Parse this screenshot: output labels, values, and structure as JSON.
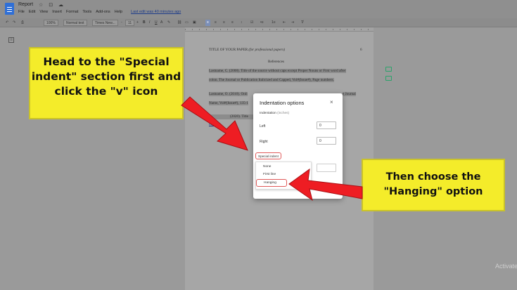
{
  "app": {
    "doc_title": "Report",
    "title_icons": "☆ ⊡ ☁",
    "menu": [
      "File",
      "Edit",
      "View",
      "Insert",
      "Format",
      "Tools",
      "Add-ons",
      "Help"
    ],
    "last_edit": "Last edit was 40 minutes ago"
  },
  "toolbar": {
    "undo": "↶",
    "redo": "↷",
    "print": "⎙",
    "zoom": "100%",
    "style": "Normal text",
    "font": "Times New...",
    "font_size": "11",
    "bold": "B",
    "italic": "I",
    "underline": "U",
    "text_color": "A",
    "minus": "-",
    "plus": "+"
  },
  "document": {
    "header_title": "TITLE OF YOUR PAPER",
    "header_subtitle": "(for professional papers)",
    "page_number": "6",
    "references_heading": "References",
    "ref1_line1": "Lastname, C. (2008). Title of the source without caps except Proper Nouns or  First word after",
    "ref1_line2": "colon. The Journal or Publication Italicized and Capped, Vol#(Issue#), Page numbers.",
    "ref2_line1_start": "Lastname, O. (2010). Onli",
    "ref2_line1_end": "e Journal",
    "ref2_line2": "Name, Vol#(Issue#), 135-1",
    "ref3_fragment": "(2020). Title",
    "ref3_link": "http://"
  },
  "dialog": {
    "title": "Indentation options",
    "close": "×",
    "section": "Indentation",
    "section_unit": "(inches)",
    "left_label": "Left",
    "left_value": "0",
    "right_label": "Right",
    "right_value": "0",
    "special_label": "Special indent",
    "options": [
      "None",
      "First line",
      "Hanging"
    ]
  },
  "callouts": {
    "first": "Head to the \"Special indent\" section first and click the \"v\" icon",
    "second": "Then choose the \"Hanging\" option"
  },
  "watermark": "Activate"
}
